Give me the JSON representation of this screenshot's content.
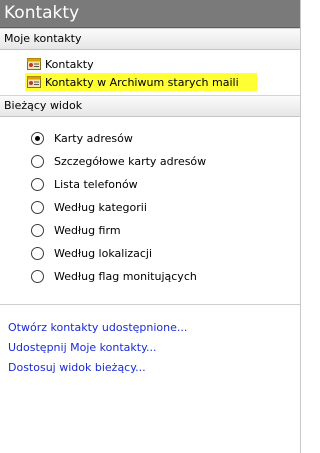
{
  "header": {
    "title": "Kontakty"
  },
  "my_contacts": {
    "heading": "Moje kontakty",
    "items": [
      {
        "label": "Kontakty",
        "icon": "contact-card-icon"
      },
      {
        "label": "Kontakty w Archiwum starych maili",
        "icon": "contact-card-icon"
      }
    ]
  },
  "current_view": {
    "heading": "Bieżący widok",
    "options": [
      {
        "label": "Karty adresów",
        "selected": true
      },
      {
        "label": "Szczegółowe karty adresów",
        "selected": false
      },
      {
        "label": "Lista telefonów",
        "selected": false
      },
      {
        "label": "Według kategorii",
        "selected": false
      },
      {
        "label": "Według firm",
        "selected": false
      },
      {
        "label": "Według lokalizacji",
        "selected": false
      },
      {
        "label": "Według flag monitujących",
        "selected": false
      }
    ]
  },
  "links": [
    "Otwórz kontakty udostępnione...",
    "Udostępnij Moje kontakty...",
    "Dostosuj widok bieżący..."
  ],
  "colors": {
    "header_bg": "#7a7a7a",
    "highlight": "#ffff33",
    "link": "#1a2bd6"
  }
}
